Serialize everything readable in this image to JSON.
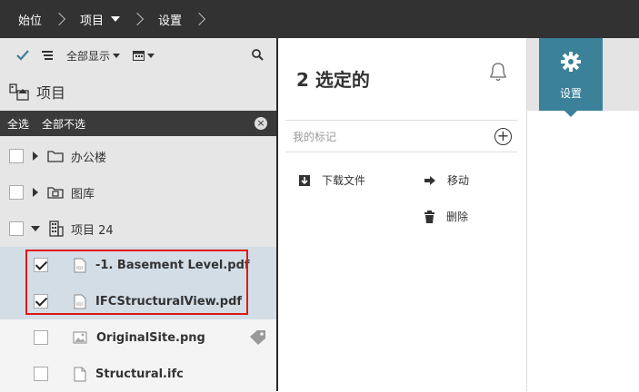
{
  "breadcrumb": {
    "home": "始位",
    "project": "项目",
    "settings": "设置"
  },
  "toolbar": {
    "show_all": "全部显示"
  },
  "panel": {
    "title": "项目",
    "select_all": "全选",
    "deselect_all": "全部不选"
  },
  "tree": {
    "office": "办公楼",
    "drawings": "图库",
    "project24": "项目 24",
    "file1": "-1. Basement Level.pdf",
    "file2": "IFCStructuralView.pdf",
    "file3": "OriginalSite.png",
    "file4": "Structural.ifc"
  },
  "selection": {
    "count_title": "2 选定的",
    "tags_placeholder": "我的标记",
    "download": "下载文件",
    "move": "移动",
    "delete": "删除"
  },
  "right": {
    "settings_tab": "设置"
  },
  "colors": {
    "accent": "#3b8199",
    "selection_row": "#d3dde6",
    "highlight_box": "#e01818",
    "topbar": "#323232"
  }
}
